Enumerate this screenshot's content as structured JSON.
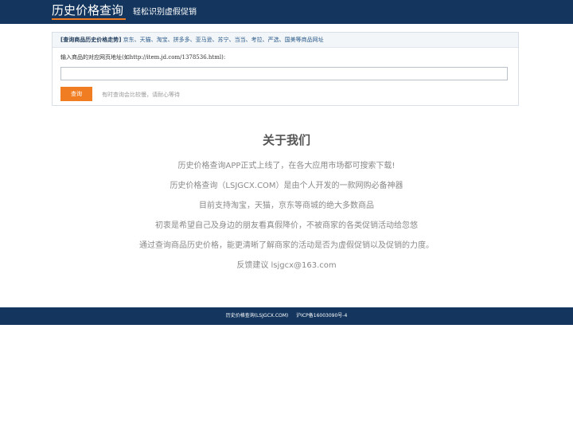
{
  "header": {
    "logo_text": "历史价格查询",
    "slogan": "轻松识别虚假促销"
  },
  "search_panel": {
    "title_bold": "[查询商品历史价格走势]",
    "title_sites": "京东、天猫、淘宝、拼多多、亚马逊、苏宁、当当、考拉、严选、国美等商品网址",
    "input_label": "输入商品的对应网页地址(如",
    "input_label_example": "http://item.jd.com/1378536.html",
    "input_label_end": "):",
    "input_value": "",
    "button_label": "查询",
    "note": "有时查询会比较慢，请耐心等待"
  },
  "about": {
    "title": "关于我们",
    "lines": [
      "历史价格查询APP正式上线了，在各大应用市场都可搜索下载!",
      "历史价格查询（LSJGCX.COM）是由个人开发的一款网购必备神器",
      "目前支持淘宝，天猫，京东等商城的绝大多数商品",
      "初衷是希望自己及身边的朋友看真假降价，不被商家的各类促销活动给忽悠",
      "通过查询商品历史价格，能更清晰了解商家的活动是否为虚假促销以及促销的力度。",
      "反馈建议 lsjgcx@163.com"
    ]
  },
  "footer": {
    "site": "历史价格查询(LSJGCX.COM)",
    "icp": "沪ICP备16003090号-4"
  },
  "colors": {
    "brand_navy": "#14365e",
    "accent_orange": "#f07d22"
  }
}
